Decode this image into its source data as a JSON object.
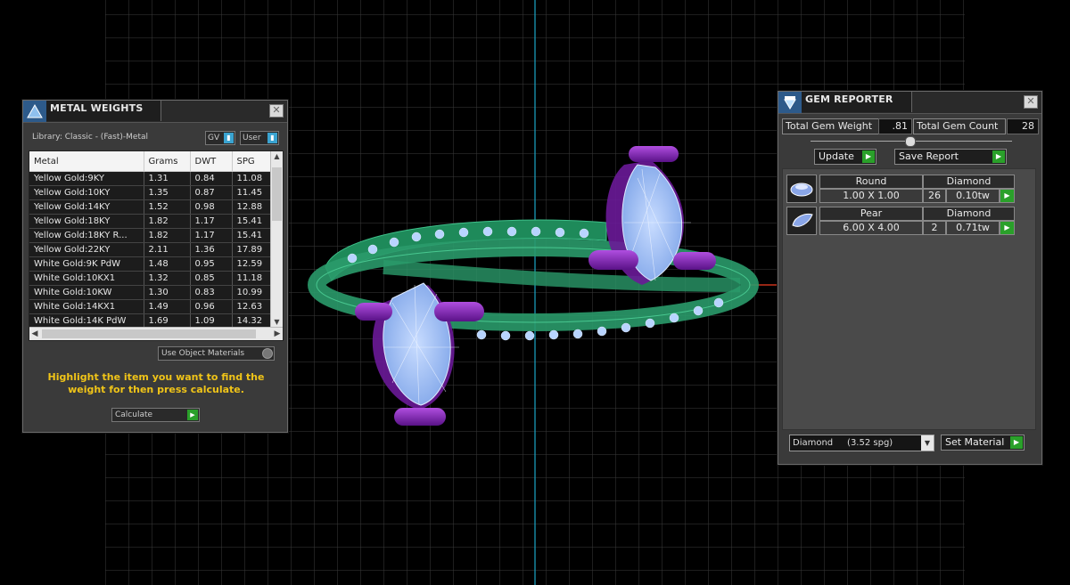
{
  "metal_weights": {
    "title": "METAL WEIGHTS",
    "library_label": "Library: Classic - (Fast)-Metal",
    "gv_label": "GV",
    "user_label": "User",
    "columns": [
      "Metal",
      "Grams",
      "DWT",
      "SPG"
    ],
    "rows": [
      [
        "Yellow Gold:9KY",
        "1.31",
        "0.84",
        "11.08"
      ],
      [
        "Yellow Gold:10KY",
        "1.35",
        "0.87",
        "11.45"
      ],
      [
        "Yellow Gold:14KY",
        "1.52",
        "0.98",
        "12.88"
      ],
      [
        "Yellow Gold:18KY",
        "1.82",
        "1.17",
        "15.41"
      ],
      [
        "Yellow Gold:18KY R...",
        "1.82",
        "1.17",
        "15.41"
      ],
      [
        "Yellow Gold:22KY",
        "2.11",
        "1.36",
        "17.89"
      ],
      [
        "White Gold:9K PdW",
        "1.48",
        "0.95",
        "12.59"
      ],
      [
        "White Gold:10KX1",
        "1.32",
        "0.85",
        "11.18"
      ],
      [
        "White Gold:10KW",
        "1.30",
        "0.83",
        "10.99"
      ],
      [
        "White Gold:14KX1",
        "1.49",
        "0.96",
        "12.63"
      ],
      [
        "White Gold:14K PdW",
        "1.69",
        "1.09",
        "14.32"
      ]
    ],
    "use_object_materials_label": "Use Object Materials",
    "hint": "Highlight the item you want to find the weight for then press calculate.",
    "calculate_label": "Calculate"
  },
  "gem_reporter": {
    "title": "GEM REPORTER",
    "total_weight_label": "Total Gem Weight",
    "total_weight_value": ".81",
    "total_count_label": "Total Gem Count",
    "total_count_value": "28",
    "update_label": "Update",
    "save_report_label": "Save Report",
    "gems": [
      {
        "shape": "Round",
        "material": "Diamond",
        "size": "1.00 X 1.00",
        "count": "26",
        "weight": "0.10tw"
      },
      {
        "shape": "Pear",
        "material": "Diamond",
        "size": "6.00 X 4.00",
        "count": "2",
        "weight": "0.71tw"
      }
    ],
    "material_select": "Diamond     (3.52 spg)",
    "set_material_label": "Set Material"
  },
  "colors": {
    "grid": "#3a3a3a",
    "axis_y": "#1aa6c8",
    "axis_x": "#c8321a",
    "band": "#1e8a5a",
    "gem_fill": "#8ab6f0",
    "prong": "#7a22a8",
    "hint_text": "#f0c418"
  }
}
